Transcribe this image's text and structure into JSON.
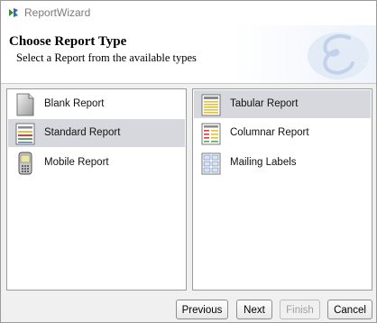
{
  "window": {
    "title": "ReportWizard"
  },
  "header": {
    "title": "Choose Report Type",
    "subtitle": "Select a Report from the available types"
  },
  "left_list": {
    "items": [
      {
        "label": "Blank Report",
        "icon": "blank-report-icon",
        "selected": false
      },
      {
        "label": "Standard Report",
        "icon": "standard-report-icon",
        "selected": true
      },
      {
        "label": "Mobile Report",
        "icon": "mobile-report-icon",
        "selected": false
      }
    ]
  },
  "right_list": {
    "items": [
      {
        "label": "Tabular Report",
        "icon": "tabular-report-icon",
        "selected": true
      },
      {
        "label": "Columnar Report",
        "icon": "columnar-report-icon",
        "selected": false
      },
      {
        "label": "Mailing Labels",
        "icon": "mailing-labels-icon",
        "selected": false
      }
    ]
  },
  "buttons": {
    "previous": "Previous",
    "next": "Next",
    "finish": "Finish",
    "cancel": "Cancel"
  },
  "colors": {
    "selected_row": "#d6d8de",
    "header_accent": "#eef3fb"
  }
}
